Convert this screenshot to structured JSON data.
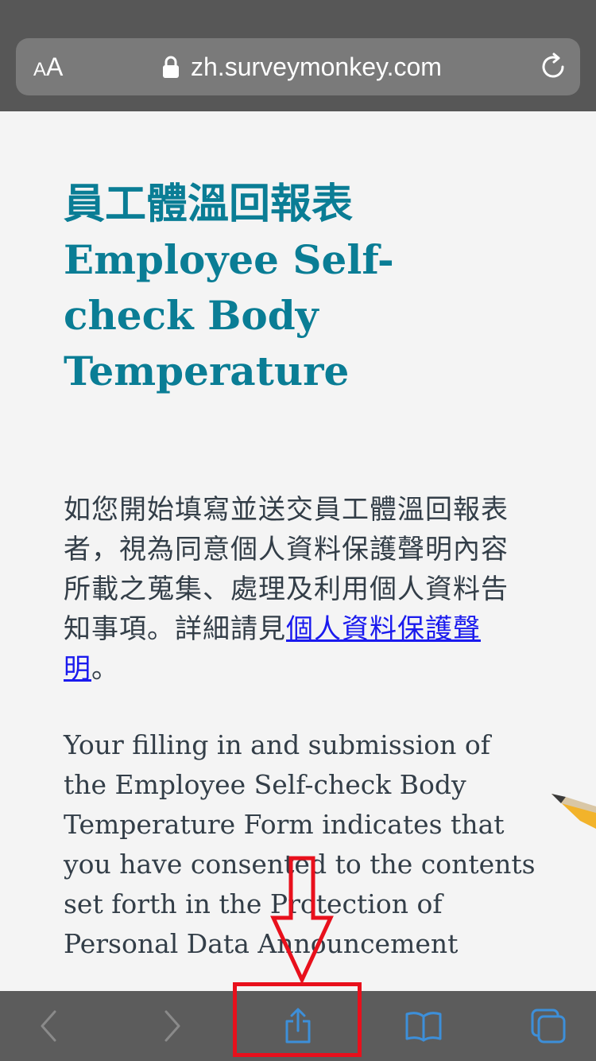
{
  "browser": {
    "text_size_small": "A",
    "text_size_large": "A",
    "url": "zh.surveymonkey.com",
    "icons": {
      "lock": "lock-icon",
      "reload": "reload-icon",
      "back": "chevron-left-icon",
      "forward": "chevron-right-icon",
      "share": "share-icon",
      "bookmarks": "book-icon",
      "tabs": "tabs-icon"
    }
  },
  "page": {
    "title_zh": "員工體溫回報表",
    "title_en_line1": "Employee Self-",
    "title_en_line2": "check Body",
    "title_en_line3": "Temperature",
    "intro_zh": "如您開始填寫並送交員工體溫回報表者，視為同意個人資料保護聲明內容所載之蒐集、處理及利用個人資料告知事項。詳細請見",
    "intro_zh_link": "個人資料保護聲明",
    "intro_zh_end": "。",
    "intro_en": "Your filling in and submission of the Employee Self-check Body Temperature Form indicates that you have consented to the contents set forth in the Protection of Personal Data Announcement"
  },
  "colors": {
    "title": "#0a7d95",
    "body_text": "#333e48",
    "link": "#1a1aee",
    "toolbar_icon_active": "#3d8fd9",
    "toolbar_icon_disabled": "#8a8a8a",
    "annotation": "#e8101c"
  }
}
